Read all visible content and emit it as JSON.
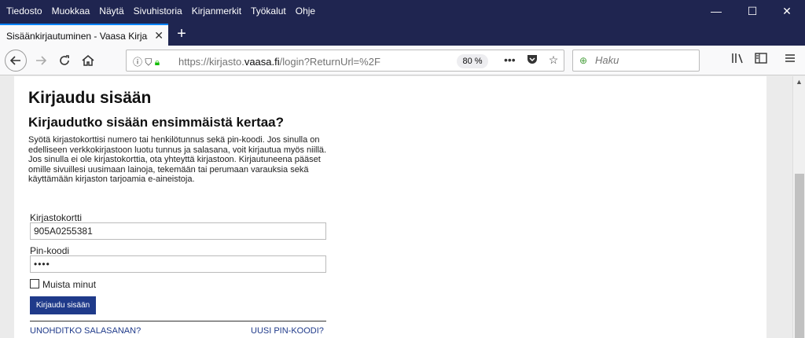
{
  "menubar": {
    "items": [
      "Tiedosto",
      "Muokkaa",
      "Näytä",
      "Sivuhistoria",
      "Kirjanmerkit",
      "Työkalut",
      "Ohje"
    ]
  },
  "window_controls": {
    "minimize": "—",
    "maximize": "☐",
    "close": "✕"
  },
  "tab": {
    "title": "Sisäänkirjautuminen - Vaasa Kirjasto",
    "close": "✕",
    "new_tab": "+"
  },
  "navbar": {
    "url_prefix": "https://kirjasto.",
    "url_host": "vaasa.fi",
    "url_path": "/login?ReturnUrl=%2F",
    "zoom": "80 %",
    "search_placeholder": "Haku"
  },
  "page": {
    "heading": "Kirjaudu sisään",
    "subheading": "Kirjaudutko sisään ensimmäistä kertaa?",
    "intro": "Syötä kirjastokorttisi numero tai henkilötunnus sekä pin-koodi. Jos sinulla on edelliseen verkkokirjastoon luotu tunnus ja salasana, voit kirjautua myös niillä. Jos sinulla ei ole kirjastokorttia, ota yhteyttä kirjastoon. Kirjautuneena pääset omille sivuillesi uusimaan lainoja, tekemään tai perumaan varauksia sekä käyttämään kirjaston tarjoamia e-aineistoja.",
    "card_label": "Kirjastokortti",
    "card_value": "905A0255381",
    "pin_label": "Pin-koodi",
    "pin_value": "••••",
    "remember_label": "Muista minut",
    "login_button": "Kirjaudu sisään",
    "forgot_link": "UNOHDITKO SALASANAN?",
    "new_pin_link": "UUSI PIN-KOODI?"
  }
}
